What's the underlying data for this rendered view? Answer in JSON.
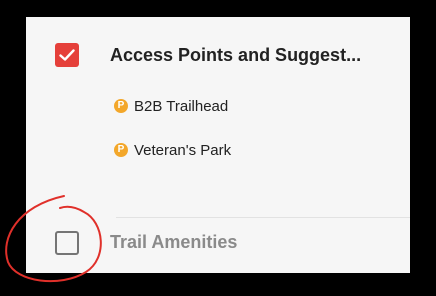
{
  "layers": [
    {
      "title": "Access Points and Suggest...",
      "checked": true,
      "items": [
        {
          "icon": "parking-icon",
          "icon_letter": "P",
          "label": "B2B Trailhead"
        },
        {
          "icon": "parking-icon",
          "icon_letter": "P",
          "label": "Veteran's Park"
        }
      ]
    },
    {
      "title": "Trail Amenities",
      "checked": false
    }
  ],
  "colors": {
    "checkbox_checked": "#e5403a",
    "parking_icon": "#f3a72a",
    "annotation_circle": "#e0302a"
  }
}
